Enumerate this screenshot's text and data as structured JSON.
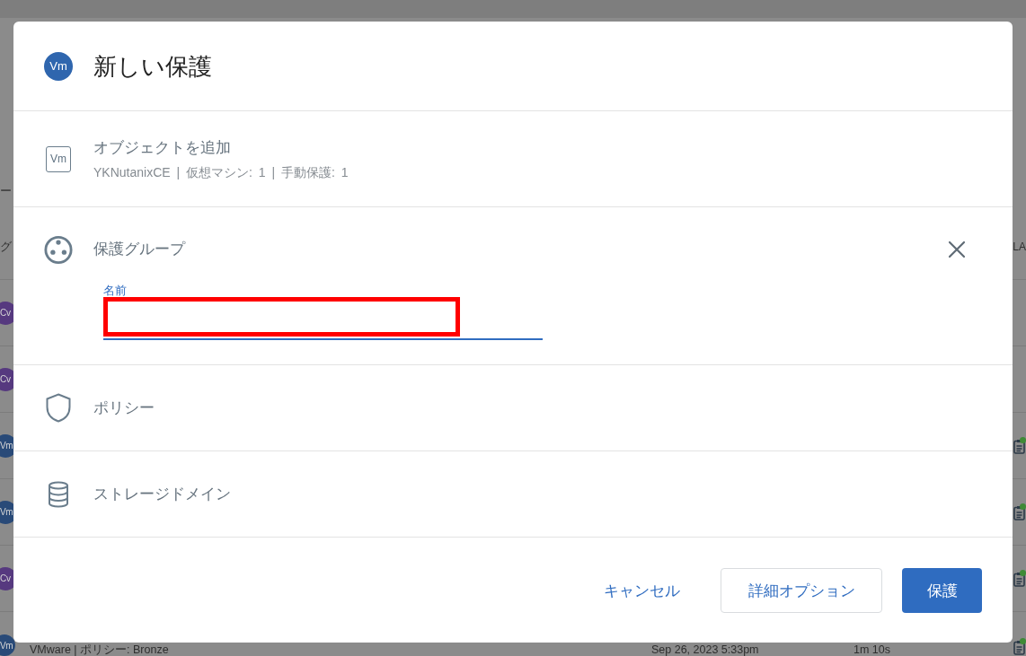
{
  "background": {
    "header_fragment": "ー",
    "column_header_fragments": [
      "グ",
      "LA"
    ],
    "rows": [
      {
        "avatar": {
          "text": "Cv",
          "color": "#56397f"
        }
      },
      {
        "avatar": {
          "text": "Cv",
          "color": "#56397f"
        }
      },
      {
        "avatar": {
          "text": "Vm",
          "color": "#294a78"
        },
        "status": {
          "color": "#3f8a36"
        }
      },
      {
        "avatar": {
          "text": "Vm",
          "color": "#294a78"
        },
        "status": {
          "color": "#3f8a36"
        }
      },
      {
        "avatar": {
          "text": "Cv",
          "color": "#56397f"
        },
        "status": {
          "color": "#3f8a36"
        }
      },
      {
        "avatar": {
          "text": "Vm",
          "color": "#294a78"
        },
        "status": {
          "color": "#3f8a36"
        },
        "subtitle": "VMware | ポリシー: Bronze",
        "date": "Sep 26, 2023 5:33pm",
        "duration": "1m 10s"
      }
    ]
  },
  "dialog": {
    "icon": "Vm",
    "title": "新しい保護",
    "sections": [
      {
        "kind": "objects",
        "icon": "Vm",
        "title": "オブジェクトを追加",
        "subtitle": "YKNutanixCE | 仮想マシン: 1 | 手動保護: 1"
      },
      {
        "kind": "group",
        "title": "保護グループ",
        "closable": true,
        "field": {
          "label": "名前",
          "highlighted": true
        }
      },
      {
        "kind": "policy",
        "title": "ポリシー"
      },
      {
        "kind": "storage",
        "title": "ストレージドメイン"
      }
    ],
    "buttons": [
      {
        "label": "キャンセル",
        "kind": "text"
      },
      {
        "label": "詳細オプション",
        "kind": "outlined"
      },
      {
        "label": "保護",
        "kind": "primary"
      }
    ]
  }
}
